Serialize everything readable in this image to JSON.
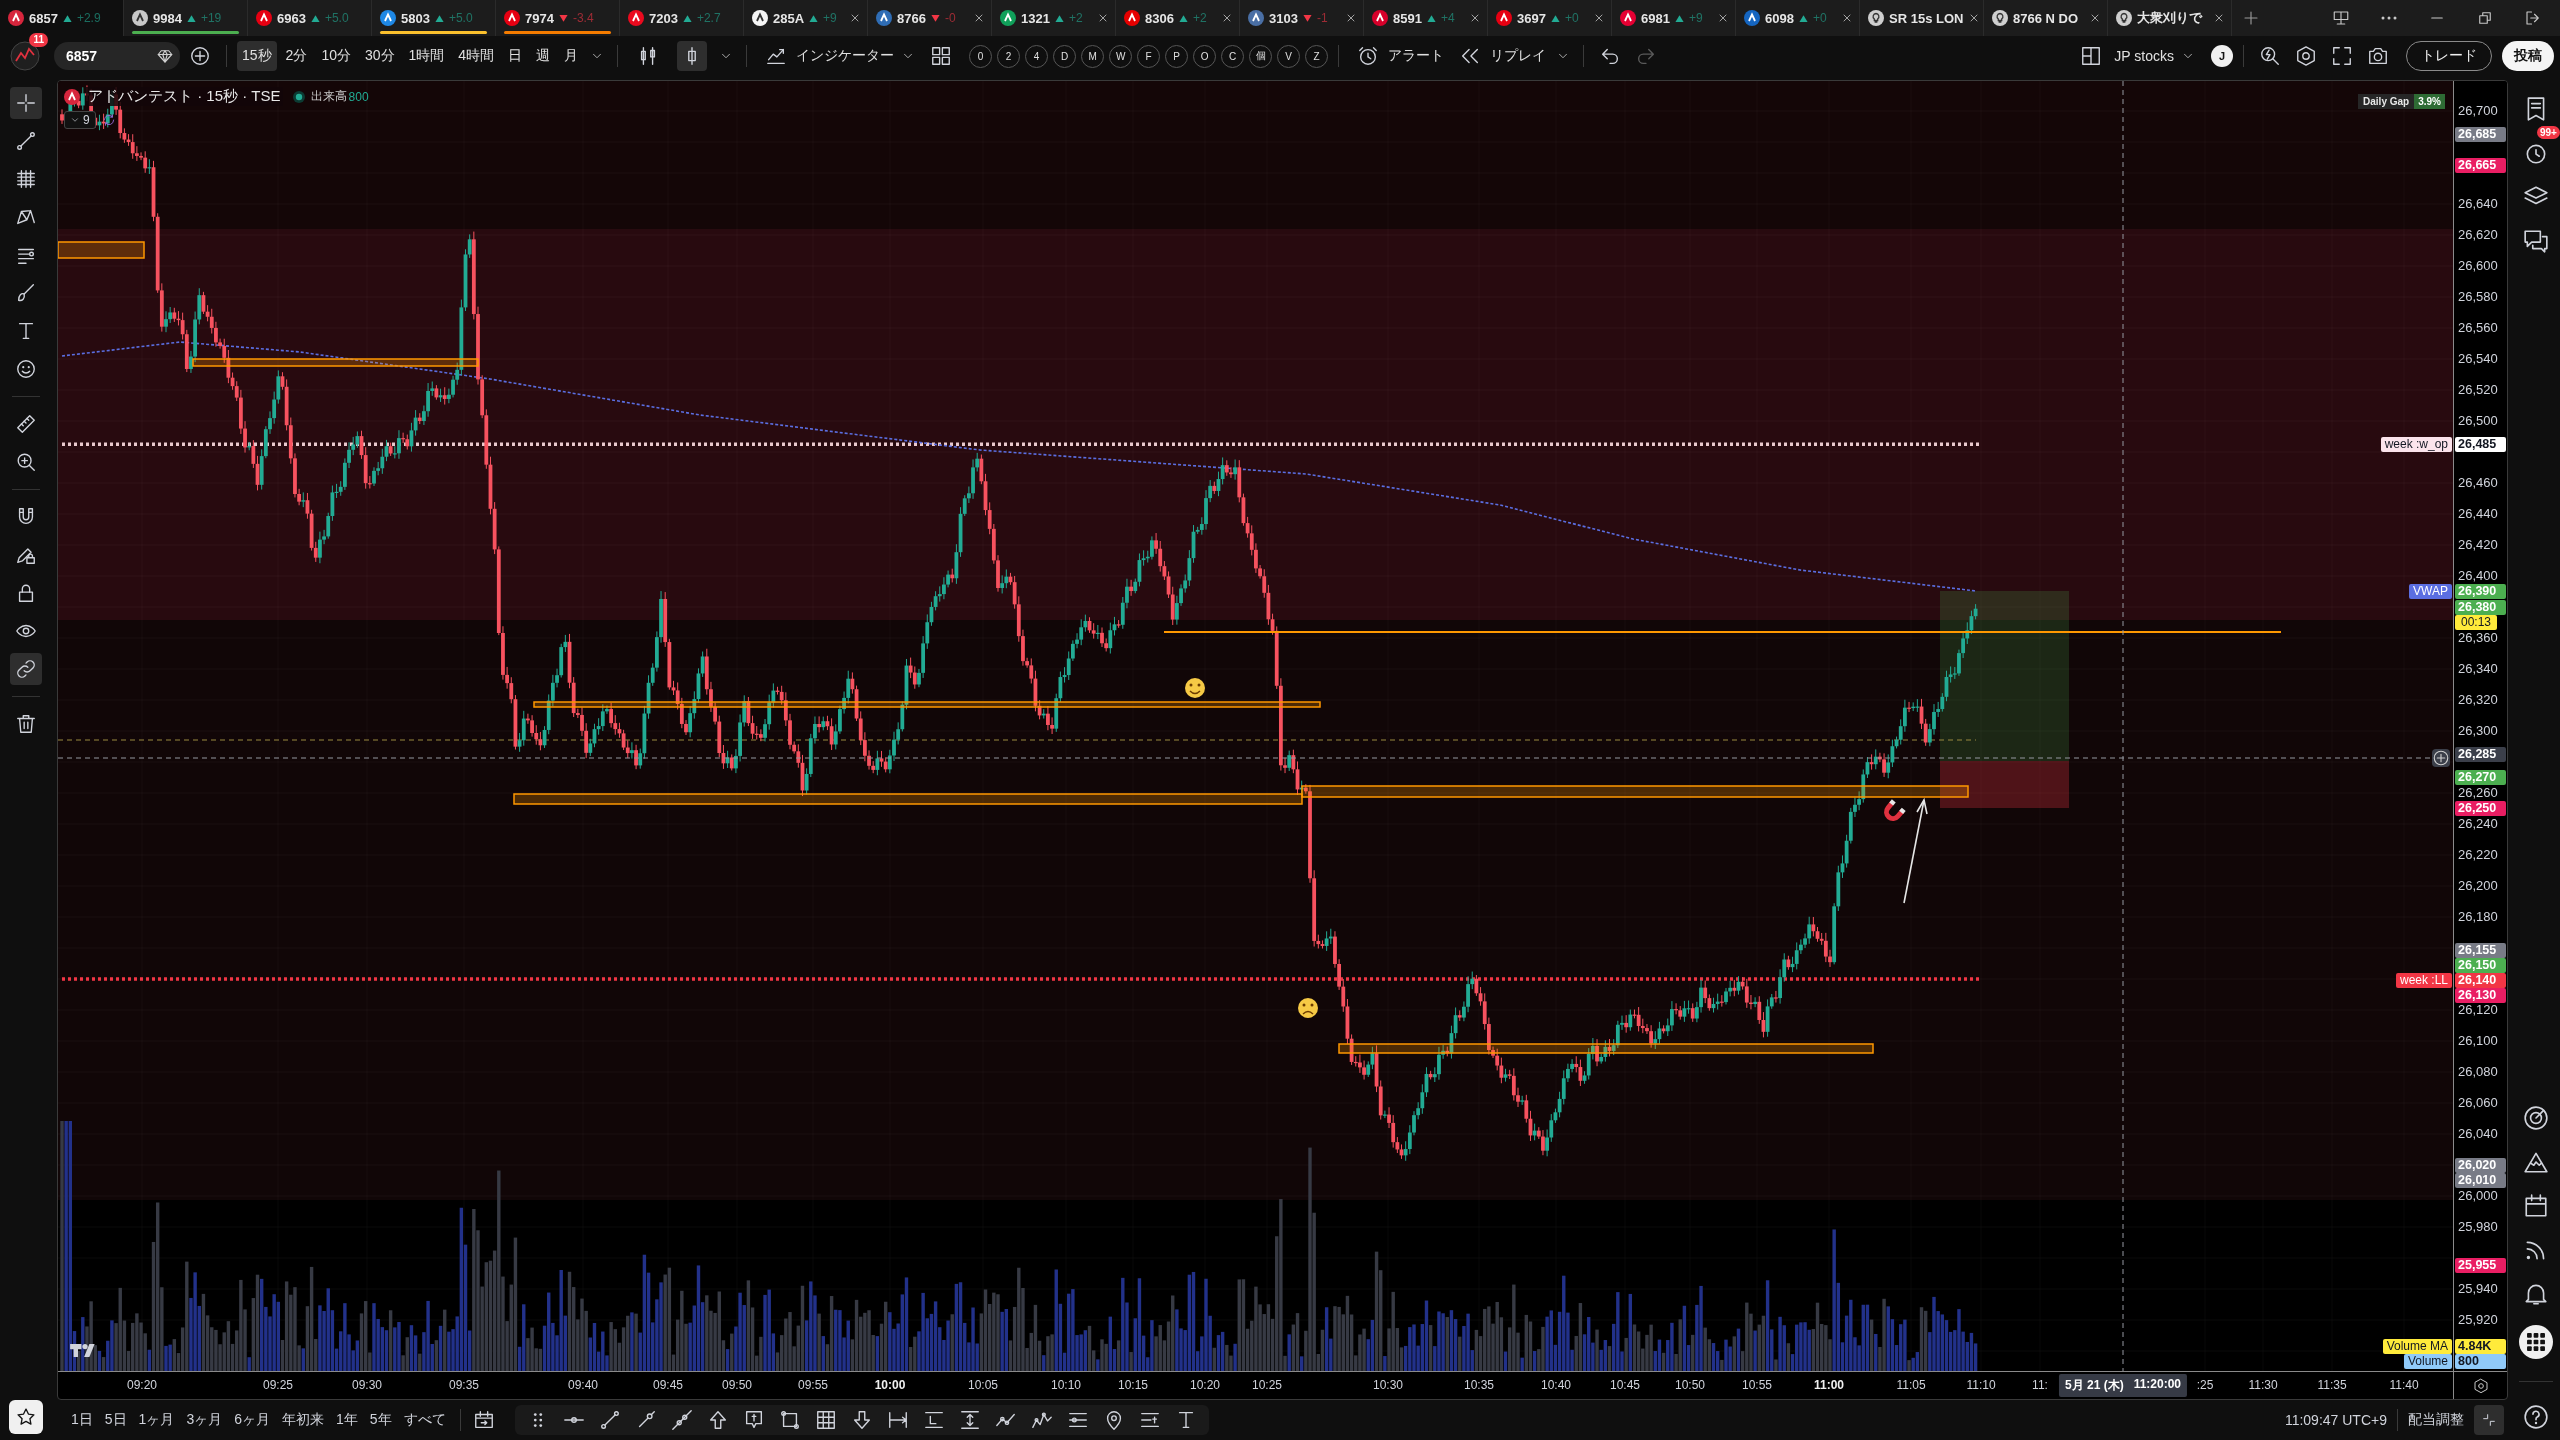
{
  "tabs": [
    {
      "kind": "symbol",
      "symbol": "6857",
      "rising": true,
      "change": "+2.9",
      "selected": true,
      "closable": false,
      "color": "#d7263d"
    },
    {
      "kind": "symbol",
      "symbol": "9984",
      "rising": true,
      "change": "+19",
      "selected": false,
      "closable": false,
      "color": "#c9c9c9",
      "underline": {
        "color": "#4caf50"
      }
    },
    {
      "kind": "symbol",
      "symbol": "6963",
      "rising": true,
      "change": "+5.0",
      "selected": false,
      "closable": false,
      "color": "#e60012"
    },
    {
      "kind": "symbol",
      "symbol": "5803",
      "rising": true,
      "change": "+5.0",
      "selected": false,
      "closable": false,
      "color": "#1e88e5",
      "underline": {
        "color": "#fbc02d"
      }
    },
    {
      "kind": "symbol",
      "symbol": "7974",
      "rising": false,
      "change": "-3.4",
      "selected": false,
      "closable": false,
      "color": "#e60012",
      "underline": {
        "color": "#f57c00"
      }
    },
    {
      "kind": "symbol",
      "symbol": "7203",
      "rising": true,
      "change": "+2.7",
      "selected": false,
      "closable": false,
      "color": "#eb0a1e"
    },
    {
      "kind": "symbol",
      "symbol": "285A",
      "rising": true,
      "change": "+9",
      "selected": false,
      "closable": true,
      "color": "#f5f5f5"
    },
    {
      "kind": "symbol",
      "symbol": "8766",
      "rising": false,
      "change": "-0",
      "selected": false,
      "closable": true,
      "color": "#2f6db5"
    },
    {
      "kind": "symbol",
      "symbol": "1321",
      "rising": true,
      "change": "+2",
      "selected": false,
      "closable": true,
      "color": "#10a05a"
    },
    {
      "kind": "symbol",
      "symbol": "8306",
      "rising": true,
      "change": "+2",
      "selected": false,
      "closable": true,
      "color": "#e60000"
    },
    {
      "kind": "symbol",
      "symbol": "3103",
      "rising": false,
      "change": "-1",
      "selected": false,
      "closable": true,
      "color": "#4a6fa5"
    },
    {
      "kind": "symbol",
      "symbol": "8591",
      "rising": true,
      "change": "+4",
      "selected": false,
      "closable": true,
      "color": "#d6002a"
    },
    {
      "kind": "symbol",
      "symbol": "3697",
      "rising": true,
      "change": "+0",
      "selected": false,
      "closable": true,
      "color": "#e60012"
    },
    {
      "kind": "symbol",
      "symbol": "6981",
      "rising": true,
      "change": "+9",
      "selected": false,
      "closable": true,
      "color": "#e60033"
    },
    {
      "kind": "symbol",
      "symbol": "6098",
      "rising": true,
      "change": "+0",
      "selected": false,
      "closable": true,
      "color": "#1565c0"
    },
    {
      "kind": "idea",
      "symbol": "SR 15s LON",
      "selected": false,
      "closable": true
    },
    {
      "kind": "idea",
      "symbol": "8766 N DO",
      "selected": false,
      "closable": true
    },
    {
      "kind": "idea",
      "symbol": "大衆刈りで",
      "selected": false,
      "closable": true
    }
  ],
  "toolbar": {
    "notification_count": "11",
    "symbol": "6857",
    "intervals": [
      {
        "label": "15秒",
        "selected": true
      },
      {
        "label": "2分",
        "selected": false
      },
      {
        "label": "10分",
        "selected": false
      },
      {
        "label": "30分",
        "selected": false
      },
      {
        "label": "1時間",
        "selected": false
      },
      {
        "label": "4時間",
        "selected": false
      },
      {
        "label": "日",
        "selected": false
      },
      {
        "label": "週",
        "selected": false
      },
      {
        "label": "月",
        "selected": false
      }
    ],
    "chart_styles": [
      {
        "kind": "candles",
        "selected": false
      },
      {
        "kind": "hollow-candle",
        "selected": true
      }
    ],
    "indicators": "インジケーター",
    "quick_buttons": [
      "0",
      "2",
      "4",
      "D",
      "M",
      "W",
      "F",
      "P",
      "O",
      "C",
      "個",
      "V",
      "Z"
    ],
    "alert": "アラート",
    "replay": "リプレイ",
    "layout": "JP stocks",
    "account": "J",
    "trade": "トレード",
    "publish": "投稿"
  },
  "left_toolbar": {
    "tools": [
      {
        "kind": "crosshair",
        "selected": true
      },
      {
        "kind": "trend-line",
        "selected": false
      },
      {
        "kind": "fib",
        "selected": false
      },
      {
        "kind": "pattern",
        "selected": false
      },
      {
        "kind": "projection",
        "selected": false
      },
      {
        "kind": "brush",
        "selected": false
      },
      {
        "kind": "text",
        "selected": false
      },
      {
        "kind": "emoji",
        "selected": false
      },
      {
        "kind": "ruler",
        "selected": false
      },
      {
        "kind": "zoom",
        "selected": false
      },
      {
        "kind": "magnet",
        "selected": false
      },
      {
        "kind": "draw-lock",
        "selected": false
      },
      {
        "kind": "lock",
        "selected": false
      },
      {
        "kind": "eye",
        "selected": false
      },
      {
        "kind": "link",
        "selected": true
      },
      {
        "kind": "trash",
        "selected": false
      }
    ]
  },
  "chart": {
    "legend": {
      "title": "アドバンテスト · 15秒 · TSE",
      "market_open": true,
      "volume_label": "出来高",
      "volume_value": "800",
      "indicator_count": "9"
    },
    "daily_gap": {
      "label": "Daily Gap",
      "value": "3.9%"
    },
    "price_ticks": [
      "26,700",
      "26,640",
      "26,620",
      "26,600",
      "26,580",
      "26,560",
      "26,540",
      "26,520",
      "26,500",
      "26,460",
      "26,440",
      "26,420",
      "26,400",
      "26,360",
      "26,340",
      "26,320",
      "26,300",
      "26,260",
      "26,240",
      "26,220",
      "26,200",
      "26,180",
      "26,120",
      "26,100",
      "26,080",
      "26,060",
      "26,040",
      "26,000",
      "25,980",
      "25,940",
      "25,920"
    ],
    "price_badges": [
      {
        "value": "26,685",
        "color": "#787b86"
      },
      {
        "value": "26,665",
        "color": "#e91e63"
      },
      {
        "value": "26,485",
        "color": "#ffffff",
        "tag": {
          "label": "week :w_op",
          "color": "#fce4ec"
        }
      },
      {
        "value": "26,390",
        "color": "#4caf50",
        "tag": {
          "label": "VWAP",
          "color": "#5b6ee1"
        }
      },
      {
        "value": "26,380",
        "color": "#4caf50",
        "countdown": "00:13"
      },
      {
        "value": "26,270",
        "color": "#4caf50"
      },
      {
        "value": "26,250",
        "color": "#e91e63"
      },
      {
        "value": "26,155",
        "color": "#787b86"
      },
      {
        "value": "26,150",
        "color": "#4caf50"
      },
      {
        "value": "26,140",
        "color": "#f23645",
        "tag": {
          "label": "week :LL",
          "color": "#f23645"
        }
      },
      {
        "value": "26,130",
        "color": "#e91e63"
      },
      {
        "value": "26,020",
        "color": "#787b86"
      },
      {
        "value": "26,010",
        "color": "#787b86"
      },
      {
        "value": "25,955",
        "color": "#e91e63"
      }
    ],
    "volume_badges": [
      {
        "label": "Volume MA",
        "value": "4.84K",
        "color": "#ffeb3b"
      },
      {
        "label": "Volume",
        "value": "800",
        "color": "#90caf9"
      }
    ],
    "time_ticks": [
      {
        "label": "09:20",
        "major": false
      },
      {
        "label": "09:25",
        "major": false
      },
      {
        "label": "09:30",
        "major": false
      },
      {
        "label": "09:35",
        "major": false
      },
      {
        "label": "09:40",
        "major": false
      },
      {
        "label": "09:45",
        "major": false
      },
      {
        "label": "09:50",
        "major": false
      },
      {
        "label": "09:55",
        "major": false
      },
      {
        "label": "10:00",
        "major": true
      },
      {
        "label": "10:05",
        "major": false
      },
      {
        "label": "10:10",
        "major": false
      },
      {
        "label": "10:15",
        "major": false
      },
      {
        "label": "10:20",
        "major": false
      },
      {
        "label": "10:25",
        "major": false
      },
      {
        "label": "10:30",
        "major": false
      },
      {
        "label": "10:35",
        "major": false
      },
      {
        "label": "10:40",
        "major": false
      },
      {
        "label": "10:45",
        "major": false
      },
      {
        "label": "10:50",
        "major": false
      },
      {
        "label": "10:55",
        "major": false
      },
      {
        "label": "11:00",
        "major": true
      },
      {
        "label": "11:05",
        "major": false
      },
      {
        "label": "11:10",
        "major": false
      },
      {
        "label": "11:",
        "major": false
      },
      {
        "label": ":25",
        "major": false
      },
      {
        "label": "11:30",
        "major": false
      },
      {
        "label": "11:35",
        "major": false
      },
      {
        "label": "11:40",
        "major": false
      }
    ],
    "crosshair": {
      "date": "5月 21 (木)",
      "time": "11:20:00",
      "price": "26,285"
    }
  },
  "right_sidebar": {
    "alerts_badge": "99+"
  },
  "bottom_bar": {
    "ranges": [
      "1日",
      "5日",
      "1ヶ月",
      "3ヶ月",
      "6ヶ月",
      "年初来",
      "1年",
      "5年",
      "すべて"
    ],
    "clock": "11:09:47 UTC+9",
    "adjustment": "配当調整"
  }
}
